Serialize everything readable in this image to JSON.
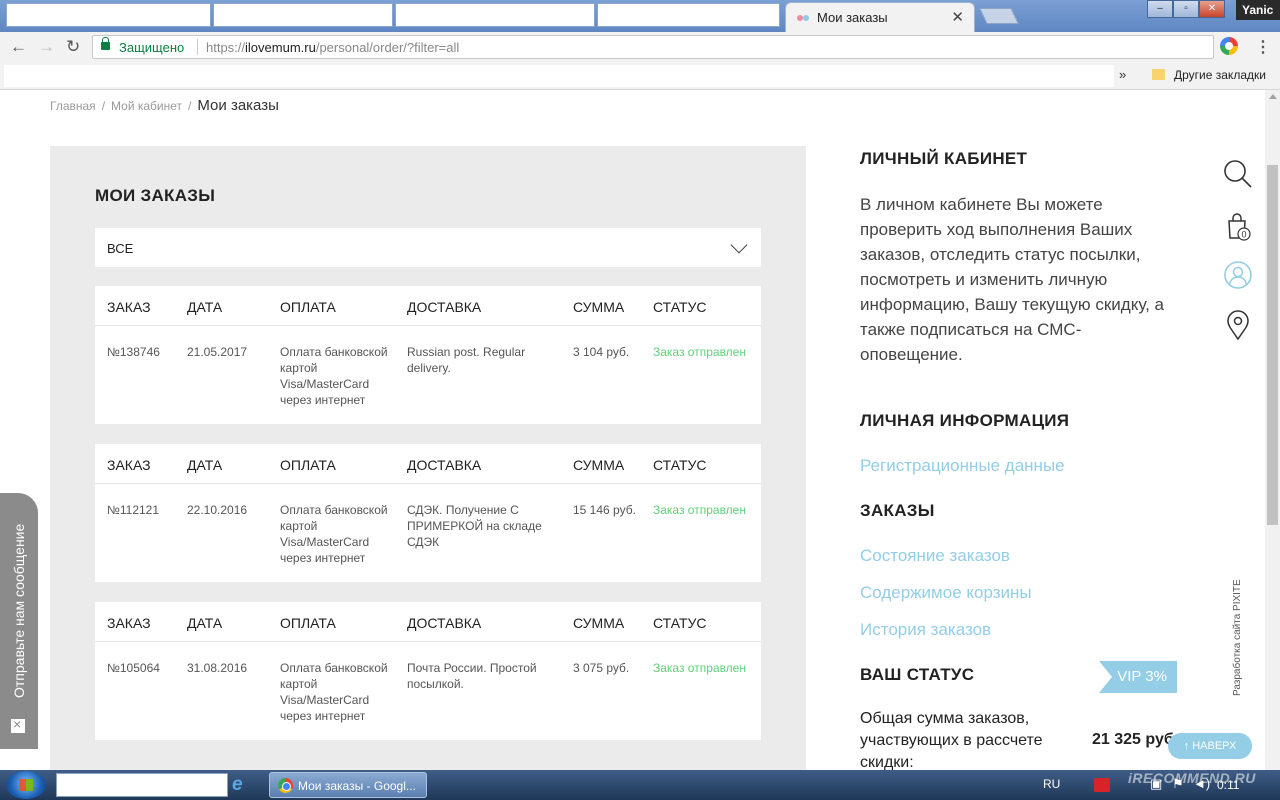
{
  "browser": {
    "tab_title": "Мои заказы",
    "secure_label": "Защищено",
    "url_prefix": "https://",
    "url_host": "ilovemum.ru",
    "url_path": "/personal/order/?filter=all",
    "bookmarks_more": "»",
    "bookmarks_folder": "Другие закладки",
    "user_name": "Yanic"
  },
  "breadcrumb": {
    "items": [
      "Главная",
      "Мой кабинет"
    ],
    "current": "Мои заказы",
    "separator": "/"
  },
  "orders": {
    "title": "МОИ ЗАКАЗЫ",
    "filter_value": "ВСЕ",
    "columns": [
      "ЗАКАЗ",
      "ДАТА",
      "ОПЛАТА",
      "ДОСТАВКА",
      "СУММА",
      "СТАТУС"
    ],
    "list": [
      {
        "number": "№138746",
        "date": "21.05.2017",
        "payment": "Оплата банковской картой Visa/MasterCard через интернет",
        "delivery": "Russian post. Regular delivery.",
        "sum": "3 104 руб.",
        "status": "Заказ отправлен"
      },
      {
        "number": "№112121",
        "date": "22.10.2016",
        "payment": "Оплата банковской картой Visa/MasterCard через интернет",
        "delivery": "СДЭК. Получение С ПРИМЕРКОЙ на складе СДЭК",
        "sum": "15 146 руб.",
        "status": "Заказ отправлен"
      },
      {
        "number": "№105064",
        "date": "31.08.2016",
        "payment": "Оплата банковской картой Visa/MasterCard через интернет",
        "delivery": "Почта России. Простой посылкой.",
        "sum": "3 075 руб.",
        "status": "Заказ отправлен"
      }
    ]
  },
  "sidebar": {
    "cabinet_title": "ЛИЧНЫЙ КАБИНЕТ",
    "cabinet_text": "В личном кабинете Вы можете проверить ход выполнения Ваших заказов, отследить статус посылки, посмотреть и изменить личную информацию, Вашу текущую скидку, а также подписаться на СМС-оповещение.",
    "personal_title": "ЛИЧНАЯ ИНФОРМАЦИЯ",
    "registration_link": "Регистрационные данные",
    "orders_title": "ЗАКАЗЫ",
    "order_links": [
      "Состояние заказов",
      "Содержимое корзины",
      "История заказов"
    ],
    "status_title": "ВАШ СТАТУС",
    "vip_badge": "VIP 3%",
    "sum_label": "Общая сумма заказов, участвующих в рассчете скидки:",
    "sum_value": "21 325 руб."
  },
  "rail": {
    "cart_count": "0",
    "credit": "Разработка сайта PIXITE"
  },
  "widgets": {
    "back_to_top": "↑ НАВЕРХ",
    "feedback": "Отправьте нам сообщение"
  },
  "taskbar": {
    "task_label": "Мои заказы - Googl...",
    "language": "RU",
    "clock": "0:11",
    "watermark": "iRECOMMEND.RU"
  },
  "colors": {
    "accent": "#93cde6",
    "status_green": "#5fd07a",
    "panel_bg": "#ebebeb"
  },
  "icons": [
    "search-icon",
    "cart-icon",
    "user-icon",
    "location-pin-icon",
    "lock-icon",
    "star-icon",
    "chevron-down-icon",
    "mail-icon"
  ]
}
